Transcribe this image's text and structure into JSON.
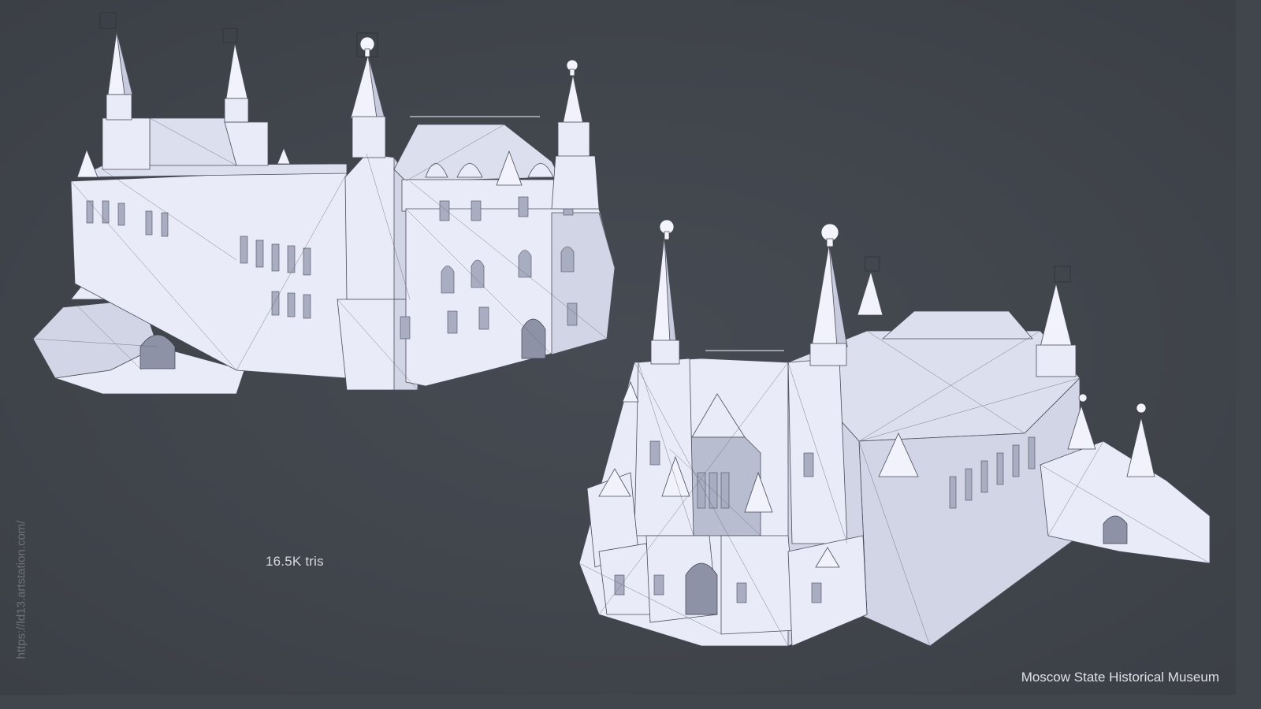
{
  "image": {
    "triangle_count_label": "16.5K tris",
    "title": "Moscow State Historical Museum",
    "watermark": "https://ld13.artstation.com/"
  },
  "colors": {
    "background": "#41454c",
    "model_surface": "#e9ebf8",
    "wireframe": "#4a4d58",
    "text": "#dfe2e6"
  },
  "models": [
    {
      "name": "museum-render-rear-view"
    },
    {
      "name": "museum-render-front-view"
    }
  ]
}
